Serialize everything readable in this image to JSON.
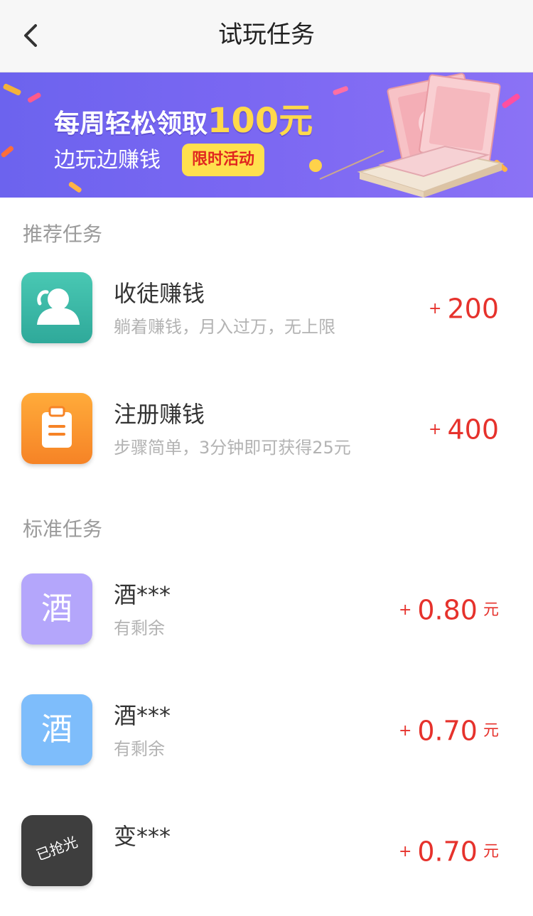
{
  "nav": {
    "title": "试玩任务",
    "back_icon": "chevron-left-icon"
  },
  "banner": {
    "headline": "每周轻松领取",
    "amount": "100元",
    "sub": "边玩边赚钱",
    "badge": "限时活动",
    "colors": {
      "bg_start": "#6c63ee",
      "bg_end": "#8b72f5",
      "amount": "#ffd94a",
      "badge_bg": "#ffe04e",
      "badge_text": "#e0261f"
    }
  },
  "sections": {
    "recommended": "推荐任务",
    "standard": "标准任务"
  },
  "recommended": [
    {
      "title": "收徒赚钱",
      "desc": "躺着赚钱，月入过万，无上限",
      "plus": "+",
      "reward": "200",
      "icon": "user-icon",
      "color": "#3cb9a7"
    },
    {
      "title": "注册赚钱",
      "desc": "步骤简单，3分钟即可获得25元",
      "plus": "+",
      "reward": "400",
      "icon": "clipboard-icon",
      "color": "#f7922e"
    }
  ],
  "standard": [
    {
      "title": "酒***",
      "desc": "有剩余",
      "plus": "+",
      "reward": "0.80",
      "unit": "元",
      "icon_char": "酒",
      "color": "#b4a6fb"
    },
    {
      "title": "酒***",
      "desc": "有剩余",
      "plus": "+",
      "reward": "0.70",
      "unit": "元",
      "icon_char": "酒",
      "color": "#7ebdfb"
    },
    {
      "title": "变***",
      "desc": "",
      "plus": "+",
      "reward": "0.70",
      "unit": "元",
      "icon_stamp": "已抢光",
      "color": "#3e3e3e"
    }
  ],
  "accent_color": "#e6322c"
}
